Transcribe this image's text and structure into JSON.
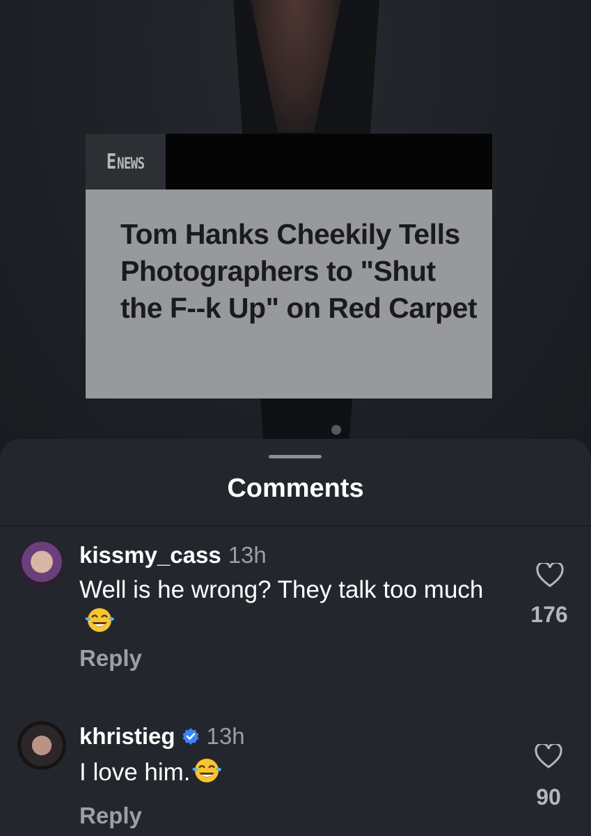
{
  "news_card": {
    "brand": "NEWS",
    "brand_mark": "E",
    "headline": "Tom Hanks Cheekily Tells Photographers to \"Shut the F--k Up\" on Red Carpet"
  },
  "comments_sheet": {
    "title": "Comments",
    "comments": [
      {
        "username": "kissmy_cass",
        "time": "13h",
        "verified": false,
        "text": "Well is he wrong? They talk too much",
        "emoji": "face-with-tears-of-joy",
        "reply_label": "Reply",
        "likes": "176"
      },
      {
        "username": "khristieg",
        "time": "13h",
        "verified": true,
        "text": "I love him.",
        "emoji": "face-with-tears-of-joy",
        "reply_label": "Reply",
        "likes": "90"
      }
    ]
  },
  "colors": {
    "sheet_bg": "#23272d",
    "verified_blue": "#3b82f6",
    "muted_text": "#9aa0a7"
  }
}
